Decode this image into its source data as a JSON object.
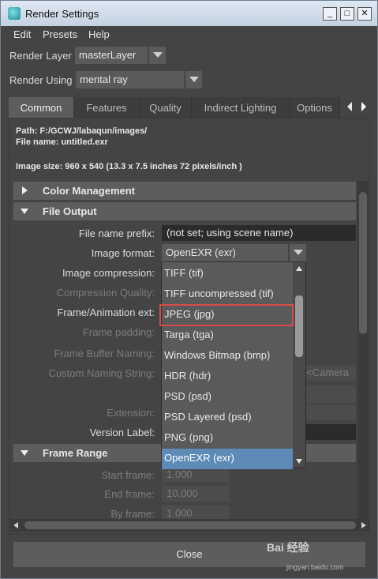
{
  "window": {
    "title": "Render Settings",
    "min": "_",
    "max": "□",
    "close": "✕"
  },
  "menu": [
    "Edit",
    "Presets",
    "Help"
  ],
  "render_layer": {
    "label": "Render Layer",
    "value": "masterLayer"
  },
  "render_using": {
    "label": "Render Using",
    "value": "mental ray"
  },
  "tabs": [
    "Common",
    "Features",
    "Quality",
    "Indirect Lighting",
    "Options"
  ],
  "info": {
    "path": "Path: F:/GCWJ/labaqun/images/",
    "file": "File name:  untitled.exr",
    "size": "Image size: 960 x 540 (13.3 x 7.5 inches 72 pixels/inch )"
  },
  "sections": {
    "color_management": "Color Management",
    "file_output": "File Output",
    "frame_range": "Frame Range"
  },
  "fields": {
    "file_name_prefix": {
      "label": "File name prefix:",
      "value": "(not set; using scene name)"
    },
    "image_format": {
      "label": "Image format:",
      "value": "OpenEXR (exr)"
    },
    "image_compression": {
      "label": "Image compression:"
    },
    "compression_quality": {
      "label": "Compression Quality:"
    },
    "frame_animation_ext": {
      "label": "Frame/Animation ext:"
    },
    "frame_padding": {
      "label": "Frame padding:"
    },
    "frame_buffer_naming": {
      "label": "Frame Buffer Naming:"
    },
    "custom_naming_string": {
      "label": "Custom Naming String:",
      "value": ">.<Camera"
    },
    "extension": {
      "label": "Extension:"
    },
    "version_label": {
      "label": "Version Label:"
    },
    "start_frame": {
      "label": "Start frame:",
      "value": "1.000"
    },
    "end_frame": {
      "label": "End frame:",
      "value": "10.000"
    },
    "by_frame": {
      "label": "By frame:",
      "value": "1.000"
    }
  },
  "dropdown_options": [
    "TIFF (tif)",
    "TIFF uncompressed (tif)",
    "JPEG (jpg)",
    "Targa (tga)",
    "Windows Bitmap (bmp)",
    "HDR (hdr)",
    "PSD (psd)",
    "PSD Layered (psd)",
    "PNG (png)",
    "OpenEXR (exr)"
  ],
  "close_button": "Close",
  "watermark": {
    "brand": "Bai 经验",
    "url": "jingyan.baidu.com"
  }
}
